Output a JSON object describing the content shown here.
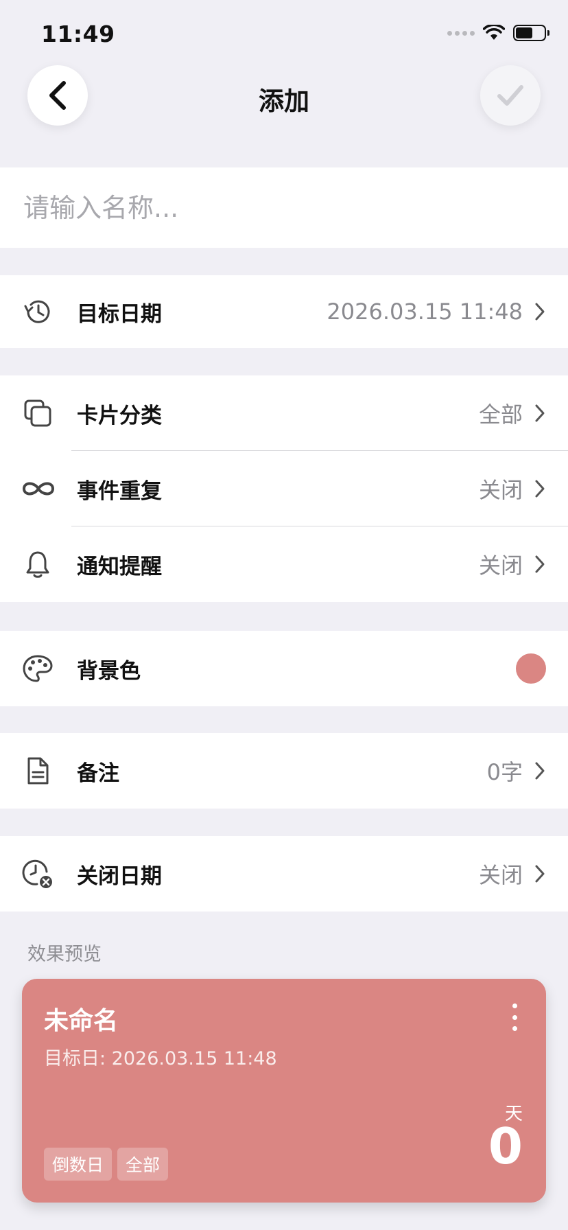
{
  "status_bar": {
    "time": "11:49"
  },
  "nav": {
    "title": "添加"
  },
  "name_input": {
    "placeholder": "请输入名称..."
  },
  "rows": {
    "target_date": {
      "label": "目标日期",
      "value": "2026.03.15 11:48",
      "icon": "history-clock-icon"
    },
    "category": {
      "label": "卡片分类",
      "value": "全部",
      "icon": "copy-stack-icon"
    },
    "repeat": {
      "label": "事件重复",
      "value": "关闭",
      "icon": "infinity-icon"
    },
    "notify": {
      "label": "通知提醒",
      "value": "关闭",
      "icon": "bell-icon"
    },
    "background": {
      "label": "背景色",
      "color": "#da8683",
      "icon": "palette-icon"
    },
    "note": {
      "label": "备注",
      "value": "0字",
      "icon": "document-icon"
    },
    "close_date": {
      "label": "关闭日期",
      "value": "关闭",
      "icon": "clock-cancel-icon"
    }
  },
  "preview": {
    "section_label": "效果预览",
    "card": {
      "title": "未命名",
      "subtitle": "目标日: 2026.03.15 11:48",
      "unit": "天",
      "count": "0",
      "tags": [
        "倒数日",
        "全部"
      ],
      "color": "#da8683"
    }
  }
}
